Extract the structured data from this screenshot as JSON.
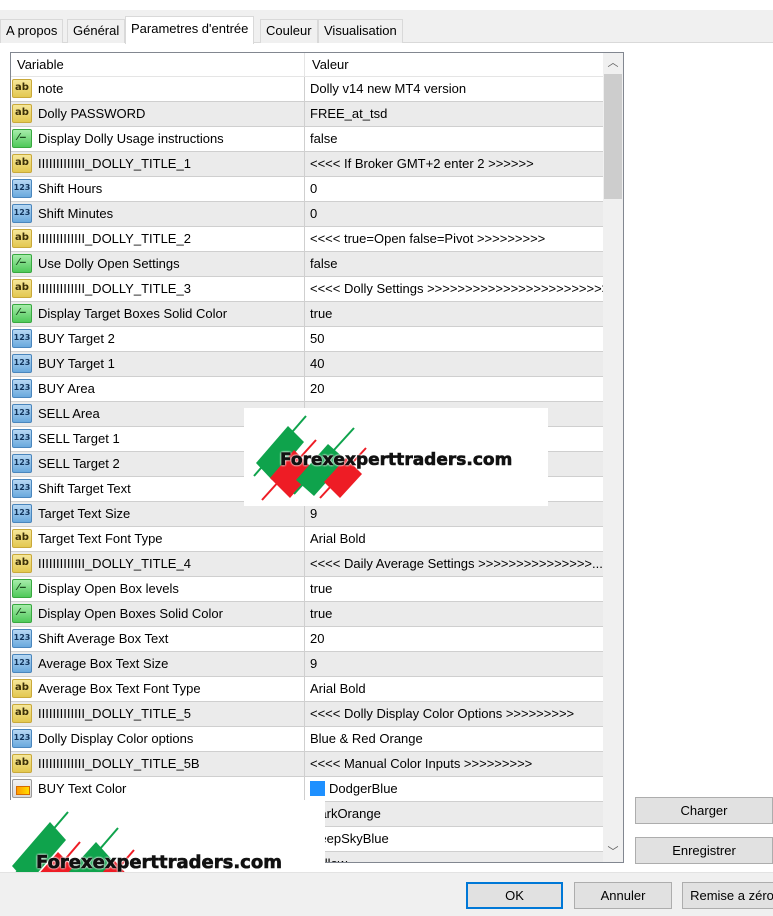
{
  "tabs": [
    {
      "label": "A propos",
      "active": false
    },
    {
      "label": "Général",
      "active": false
    },
    {
      "label": "Parametres d'entrée",
      "active": true
    },
    {
      "label": "Couleur",
      "active": false
    },
    {
      "label": "Visualisation",
      "active": false
    }
  ],
  "grid": {
    "columns": {
      "variable": "Variable",
      "value": "Valeur"
    },
    "rows": [
      {
        "type": "ab",
        "name": "note",
        "value": "Dolly v14 new MT4 version"
      },
      {
        "type": "ab",
        "name": "Dolly PASSWORD",
        "value": "FREE_at_tsd"
      },
      {
        "type": "bool",
        "name": "Display Dolly Usage instructions",
        "value": "false"
      },
      {
        "type": "ab",
        "name": "IIIIIIIIIIIII_DOLLY_TITLE_1",
        "value": "<<<< If Broker GMT+2 enter 2 >>>>>>"
      },
      {
        "type": "num",
        "name": "Shift Hours",
        "value": "0"
      },
      {
        "type": "num",
        "name": "Shift Minutes",
        "value": "0"
      },
      {
        "type": "ab",
        "name": "IIIIIIIIIIIII_DOLLY_TITLE_2",
        "value": "<<<< true=Open false=Pivot >>>>>>>>>"
      },
      {
        "type": "bool",
        "name": "Use Dolly Open Settings",
        "value": "false"
      },
      {
        "type": "ab",
        "name": "IIIIIIIIIIIII_DOLLY_TITLE_3",
        "value": "<<<< Dolly Settings >>>>>>>>>>>>>>>>>>>>>>>>"
      },
      {
        "type": "bool",
        "name": "Display Target Boxes Solid Color",
        "value": "true"
      },
      {
        "type": "num",
        "name": "BUY Target 2",
        "value": "50"
      },
      {
        "type": "num",
        "name": "BUY Target 1",
        "value": "40"
      },
      {
        "type": "num",
        "name": "BUY Area",
        "value": "20"
      },
      {
        "type": "num",
        "name": "SELL Area",
        "value": ""
      },
      {
        "type": "num",
        "name": "SELL Target 1",
        "value": ""
      },
      {
        "type": "num",
        "name": "SELL Target 2",
        "value": ""
      },
      {
        "type": "num",
        "name": "Shift Target Text",
        "value": ""
      },
      {
        "type": "num",
        "name": "Target Text Size",
        "value": "9"
      },
      {
        "type": "ab",
        "name": "Target Text Font Type",
        "value": "Arial Bold"
      },
      {
        "type": "ab",
        "name": "IIIIIIIIIIIII_DOLLY_TITLE_4",
        "value": "<<<< Daily Average Settings >>>>>>>>>>>>>>>..."
      },
      {
        "type": "bool",
        "name": "Display Open Box levels",
        "value": "true"
      },
      {
        "type": "bool",
        "name": "Display Open Boxes Solid Color",
        "value": "true"
      },
      {
        "type": "num",
        "name": "Shift Average Box Text",
        "value": "20"
      },
      {
        "type": "num",
        "name": "Average Box Text Size",
        "value": "9"
      },
      {
        "type": "ab",
        "name": "Average Box Text Font Type",
        "value": "Arial Bold"
      },
      {
        "type": "ab",
        "name": "IIIIIIIIIIIII_DOLLY_TITLE_5",
        "value": "<<<< Dolly Display Color Options >>>>>>>>>"
      },
      {
        "type": "num",
        "name": "Dolly Display Color options",
        "value": "Blue & Red Orange"
      },
      {
        "type": "ab",
        "name": "IIIIIIIIIIIII_DOLLY_TITLE_5B",
        "value": "<<<< Manual Color Inputs >>>>>>>>>"
      },
      {
        "type": "color",
        "name": "BUY Text Color",
        "value": "DodgerBlue",
        "swatch": "#1e90ff"
      },
      {
        "type": "color",
        "name": "",
        "value": "DarkOrange"
      },
      {
        "type": "color",
        "name": "",
        "value": "DeepSkyBlue"
      },
      {
        "type": "color",
        "name": "",
        "value": "Yellow"
      }
    ]
  },
  "watermark": {
    "text": "Forexexperttraders.com",
    "green": "#0fa34c",
    "red": "#ee1c25"
  },
  "buttons": {
    "load": "Charger",
    "save": "Enregistrer",
    "ok": "OK",
    "cancel": "Annuler",
    "reset": "Remise a zéro"
  },
  "scrollbar": {
    "up_icon": "chevron-up-icon",
    "down_icon": "chevron-down-icon",
    "up_glyph": "︿",
    "down_glyph": "﹀"
  }
}
